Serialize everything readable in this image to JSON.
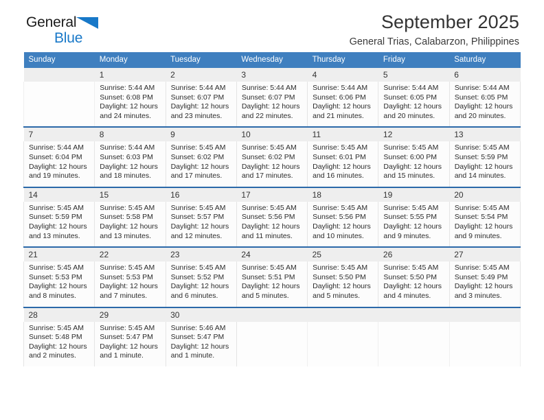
{
  "brand": {
    "word1": "General",
    "word2": "Blue",
    "triangle_color": "#1878c8",
    "word2_color": "#1878c8"
  },
  "header": {
    "title": "September 2025",
    "subtitle": "General Trias, Calabarzon, Philippines"
  },
  "theme": {
    "header_bg": "#3f7fbf",
    "week_rule": "#2a68a8",
    "daynum_bg": "#eeeeee"
  },
  "weekday_headers": [
    "Sunday",
    "Monday",
    "Tuesday",
    "Wednesday",
    "Thursday",
    "Friday",
    "Saturday"
  ],
  "weeks": [
    [
      {
        "day": "",
        "lines": []
      },
      {
        "day": "1",
        "lines": [
          "Sunrise: 5:44 AM",
          "Sunset: 6:08 PM",
          "Daylight: 12 hours",
          "and 24 minutes."
        ]
      },
      {
        "day": "2",
        "lines": [
          "Sunrise: 5:44 AM",
          "Sunset: 6:07 PM",
          "Daylight: 12 hours",
          "and 23 minutes."
        ]
      },
      {
        "day": "3",
        "lines": [
          "Sunrise: 5:44 AM",
          "Sunset: 6:07 PM",
          "Daylight: 12 hours",
          "and 22 minutes."
        ]
      },
      {
        "day": "4",
        "lines": [
          "Sunrise: 5:44 AM",
          "Sunset: 6:06 PM",
          "Daylight: 12 hours",
          "and 21 minutes."
        ]
      },
      {
        "day": "5",
        "lines": [
          "Sunrise: 5:44 AM",
          "Sunset: 6:05 PM",
          "Daylight: 12 hours",
          "and 20 minutes."
        ]
      },
      {
        "day": "6",
        "lines": [
          "Sunrise: 5:44 AM",
          "Sunset: 6:05 PM",
          "Daylight: 12 hours",
          "and 20 minutes."
        ]
      }
    ],
    [
      {
        "day": "7",
        "lines": [
          "Sunrise: 5:44 AM",
          "Sunset: 6:04 PM",
          "Daylight: 12 hours",
          "and 19 minutes."
        ]
      },
      {
        "day": "8",
        "lines": [
          "Sunrise: 5:44 AM",
          "Sunset: 6:03 PM",
          "Daylight: 12 hours",
          "and 18 minutes."
        ]
      },
      {
        "day": "9",
        "lines": [
          "Sunrise: 5:45 AM",
          "Sunset: 6:02 PM",
          "Daylight: 12 hours",
          "and 17 minutes."
        ]
      },
      {
        "day": "10",
        "lines": [
          "Sunrise: 5:45 AM",
          "Sunset: 6:02 PM",
          "Daylight: 12 hours",
          "and 17 minutes."
        ]
      },
      {
        "day": "11",
        "lines": [
          "Sunrise: 5:45 AM",
          "Sunset: 6:01 PM",
          "Daylight: 12 hours",
          "and 16 minutes."
        ]
      },
      {
        "day": "12",
        "lines": [
          "Sunrise: 5:45 AM",
          "Sunset: 6:00 PM",
          "Daylight: 12 hours",
          "and 15 minutes."
        ]
      },
      {
        "day": "13",
        "lines": [
          "Sunrise: 5:45 AM",
          "Sunset: 5:59 PM",
          "Daylight: 12 hours",
          "and 14 minutes."
        ]
      }
    ],
    [
      {
        "day": "14",
        "lines": [
          "Sunrise: 5:45 AM",
          "Sunset: 5:59 PM",
          "Daylight: 12 hours",
          "and 13 minutes."
        ]
      },
      {
        "day": "15",
        "lines": [
          "Sunrise: 5:45 AM",
          "Sunset: 5:58 PM",
          "Daylight: 12 hours",
          "and 13 minutes."
        ]
      },
      {
        "day": "16",
        "lines": [
          "Sunrise: 5:45 AM",
          "Sunset: 5:57 PM",
          "Daylight: 12 hours",
          "and 12 minutes."
        ]
      },
      {
        "day": "17",
        "lines": [
          "Sunrise: 5:45 AM",
          "Sunset: 5:56 PM",
          "Daylight: 12 hours",
          "and 11 minutes."
        ]
      },
      {
        "day": "18",
        "lines": [
          "Sunrise: 5:45 AM",
          "Sunset: 5:56 PM",
          "Daylight: 12 hours",
          "and 10 minutes."
        ]
      },
      {
        "day": "19",
        "lines": [
          "Sunrise: 5:45 AM",
          "Sunset: 5:55 PM",
          "Daylight: 12 hours",
          "and 9 minutes."
        ]
      },
      {
        "day": "20",
        "lines": [
          "Sunrise: 5:45 AM",
          "Sunset: 5:54 PM",
          "Daylight: 12 hours",
          "and 9 minutes."
        ]
      }
    ],
    [
      {
        "day": "21",
        "lines": [
          "Sunrise: 5:45 AM",
          "Sunset: 5:53 PM",
          "Daylight: 12 hours",
          "and 8 minutes."
        ]
      },
      {
        "day": "22",
        "lines": [
          "Sunrise: 5:45 AM",
          "Sunset: 5:53 PM",
          "Daylight: 12 hours",
          "and 7 minutes."
        ]
      },
      {
        "day": "23",
        "lines": [
          "Sunrise: 5:45 AM",
          "Sunset: 5:52 PM",
          "Daylight: 12 hours",
          "and 6 minutes."
        ]
      },
      {
        "day": "24",
        "lines": [
          "Sunrise: 5:45 AM",
          "Sunset: 5:51 PM",
          "Daylight: 12 hours",
          "and 5 minutes."
        ]
      },
      {
        "day": "25",
        "lines": [
          "Sunrise: 5:45 AM",
          "Sunset: 5:50 PM",
          "Daylight: 12 hours",
          "and 5 minutes."
        ]
      },
      {
        "day": "26",
        "lines": [
          "Sunrise: 5:45 AM",
          "Sunset: 5:50 PM",
          "Daylight: 12 hours",
          "and 4 minutes."
        ]
      },
      {
        "day": "27",
        "lines": [
          "Sunrise: 5:45 AM",
          "Sunset: 5:49 PM",
          "Daylight: 12 hours",
          "and 3 minutes."
        ]
      }
    ],
    [
      {
        "day": "28",
        "lines": [
          "Sunrise: 5:45 AM",
          "Sunset: 5:48 PM",
          "Daylight: 12 hours",
          "and 2 minutes."
        ]
      },
      {
        "day": "29",
        "lines": [
          "Sunrise: 5:45 AM",
          "Sunset: 5:47 PM",
          "Daylight: 12 hours",
          "and 1 minute."
        ]
      },
      {
        "day": "30",
        "lines": [
          "Sunrise: 5:46 AM",
          "Sunset: 5:47 PM",
          "Daylight: 12 hours",
          "and 1 minute."
        ]
      },
      {
        "day": "",
        "lines": []
      },
      {
        "day": "",
        "lines": []
      },
      {
        "day": "",
        "lines": []
      },
      {
        "day": "",
        "lines": []
      }
    ]
  ]
}
